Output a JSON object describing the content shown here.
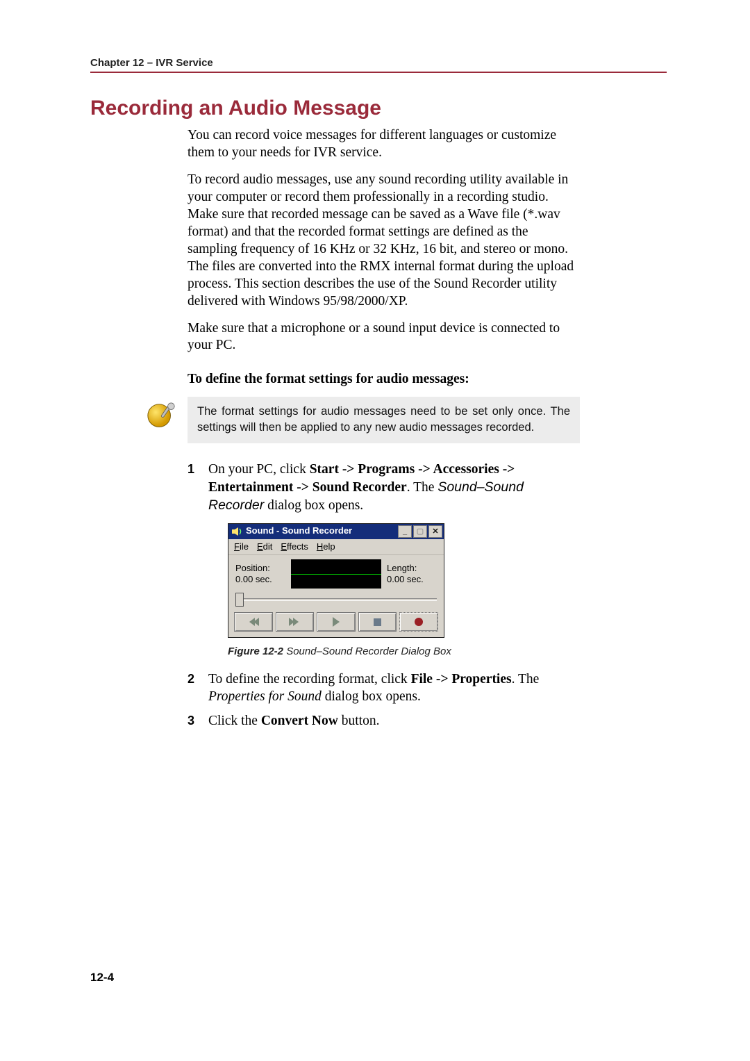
{
  "header": {
    "chapter": "Chapter 12 – IVR Service"
  },
  "title": "Recording an Audio Message",
  "paragraphs": {
    "p1": "You can record voice messages for different languages or customize them to your needs for IVR service.",
    "p2": "To record audio messages, use any sound recording utility available in your computer or record them professionally in a recording studio. Make sure that recorded message can be saved as a Wave file (*.wav format) and that the recorded format settings are defined as the sampling frequency of 16 KHz or 32 KHz, 16 bit, and stereo or mono. The files are converted into the RMX internal format during the upload process. This section describes the use of the Sound Recorder utility delivered with Windows 95/98/2000/XP.",
    "p3": "Make sure that a microphone or a sound input device is connected to your PC."
  },
  "subhead": "To define the format settings for audio messages:",
  "note": "The format settings for audio messages need to be set only once. The settings will then be applied to any new audio messages recorded.",
  "steps": {
    "s1a": "On your PC, click ",
    "s1b": "Start -> Programs -> Accessories -> Entertainment -> Sound Recorder",
    "s1c": ". The ",
    "s1d": "Sound–Sound Recorder",
    "s1e": " dialog box opens.",
    "s2a": "To define the recording format, click ",
    "s2b": "File -> Properties",
    "s2c": ". The ",
    "s2d": "Properties for Sound",
    "s2e": " dialog box opens.",
    "s3a": "Click the ",
    "s3b": "Convert Now",
    "s3c": " button."
  },
  "recorder": {
    "title": "Sound - Sound Recorder",
    "menu": {
      "file": "File",
      "edit": "Edit",
      "effects": "Effects",
      "help": "Help"
    },
    "pos_label": "Position:",
    "pos_value": "0.00 sec.",
    "len_label": "Length:",
    "len_value": "0.00 sec."
  },
  "figure": {
    "label": "Figure 12-2",
    "caption": " Sound–Sound Recorder Dialog Box"
  },
  "page_number": "12-4"
}
